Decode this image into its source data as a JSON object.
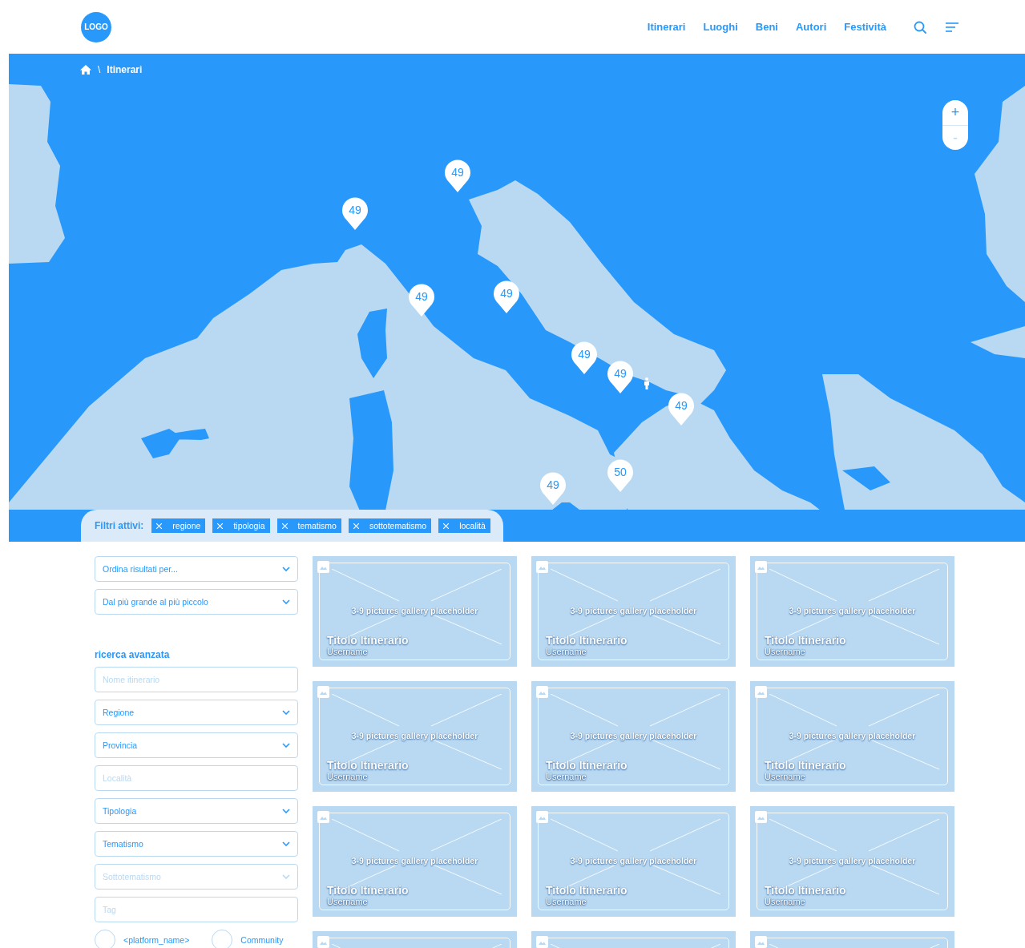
{
  "header": {
    "logo": "LOGO",
    "nav": [
      {
        "label": "Itinerari"
      },
      {
        "label": "Luoghi"
      },
      {
        "label": "Beni"
      },
      {
        "label": "Autori"
      },
      {
        "label": "Festività"
      }
    ]
  },
  "breadcrumb": {
    "separator": "\\",
    "current": "Itinerari"
  },
  "map": {
    "pins": [
      {
        "label": "49"
      },
      {
        "label": "49"
      },
      {
        "label": "49"
      },
      {
        "label": "49"
      },
      {
        "label": "49"
      },
      {
        "label": "49"
      },
      {
        "label": "49"
      },
      {
        "label": "50"
      },
      {
        "label": "49"
      }
    ],
    "zoom_in": "+",
    "zoom_out": "-"
  },
  "filters": {
    "label": "Filtri attivi:",
    "chips": [
      {
        "label": "regione"
      },
      {
        "label": "tipologia"
      },
      {
        "label": "tematismo"
      },
      {
        "label": "sottotematismo"
      },
      {
        "label": "località"
      }
    ]
  },
  "sort_fields": [
    {
      "kind": "select",
      "value": "Ordina risultati per...",
      "disabled": false
    },
    {
      "kind": "select",
      "value": "Dal più grande al più piccolo",
      "disabled": false
    }
  ],
  "advanced": {
    "title": "ricerca avanzata",
    "fields": [
      {
        "kind": "text",
        "placeholder": "Nome itinerario"
      },
      {
        "kind": "select",
        "value": "Regione",
        "disabled": false
      },
      {
        "kind": "select",
        "value": "Provincia",
        "disabled": false
      },
      {
        "kind": "text",
        "placeholder": "Località"
      },
      {
        "kind": "select",
        "value": "Tipologia",
        "disabled": false
      },
      {
        "kind": "select",
        "value": "Tematismo",
        "disabled": false
      },
      {
        "kind": "select",
        "value": "Sottotematismo",
        "disabled": true
      },
      {
        "kind": "text",
        "placeholder": "Tag"
      }
    ],
    "sources": [
      {
        "label": "<platform_name>",
        "selected": false
      },
      {
        "label": "Community",
        "selected": false
      }
    ]
  },
  "cards": [
    {
      "kind": "full",
      "caption": "3-9 pictures gallery placeholder",
      "title": "Titolo Itinerario",
      "username": "Username"
    },
    {
      "kind": "full",
      "caption": "3-9 pictures gallery placeholder",
      "title": "Titolo Itinerario",
      "username": "Username"
    },
    {
      "kind": "full",
      "caption": "3-9 pictures gallery placeholder",
      "title": "Titolo Itinerario",
      "username": "Username"
    },
    {
      "kind": "full",
      "caption": "3-9 pictures gallery placeholder",
      "title": "Titolo Itinerario",
      "username": "Username"
    },
    {
      "kind": "full",
      "caption": "3-9 pictures gallery placeholder",
      "title": "Titolo Itinerario",
      "username": "Username"
    },
    {
      "kind": "full",
      "caption": "3-9 pictures gallery placeholder",
      "title": "Titolo Itinerario",
      "username": "Username"
    },
    {
      "kind": "full",
      "caption": "3-9 pictures gallery placeholder",
      "title": "Titolo Itinerario",
      "username": "Username"
    },
    {
      "kind": "full",
      "caption": "3-9 pictures gallery placeholder",
      "title": "Titolo Itinerario",
      "username": "Username"
    },
    {
      "kind": "full",
      "caption": "3-9 pictures gallery placeholder",
      "title": "Titolo Itinerario",
      "username": "Username"
    },
    {
      "kind": "cut"
    },
    {
      "kind": "cut"
    },
    {
      "kind": "cut"
    }
  ]
}
